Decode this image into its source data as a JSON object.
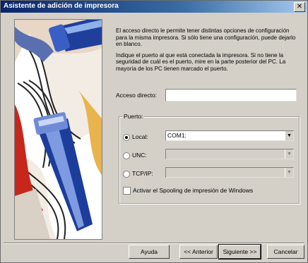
{
  "window": {
    "title": "Asistente de adición de impresora",
    "close_glyph": "✕"
  },
  "description": {
    "para1": "El acceso directo le permite tener distintas opciones de configuración para la misma impresora. Si sólo tiene una configuración, puede dejarlo en blanco.",
    "para2": "Indique el puerto al que está conectada la impresora. Si no tiene la seguridad de cuál es el puerto, mire en la parte posterior del PC. La mayoría de los PC tienen marcado el puerto."
  },
  "shortcut": {
    "label": "Acceso directo:",
    "value": ""
  },
  "port_group": {
    "legend": "Puerto:",
    "local": {
      "label": "Local:",
      "selected": true,
      "value": "COM1:"
    },
    "unc": {
      "label": "UNC:",
      "selected": false,
      "value": ""
    },
    "tcpip": {
      "label": "TCP/IP:",
      "selected": false,
      "value": ""
    },
    "spooling": {
      "label": "Activar el Spooling de impresión de Windows",
      "checked": false
    }
  },
  "buttons": {
    "help": "Ayuda",
    "back": "<< Anterior",
    "next": "Siguiente >>",
    "cancel": "Cancelar"
  },
  "icons": {
    "dropdown": "dropdown-arrow-icon",
    "close": "close-icon"
  }
}
